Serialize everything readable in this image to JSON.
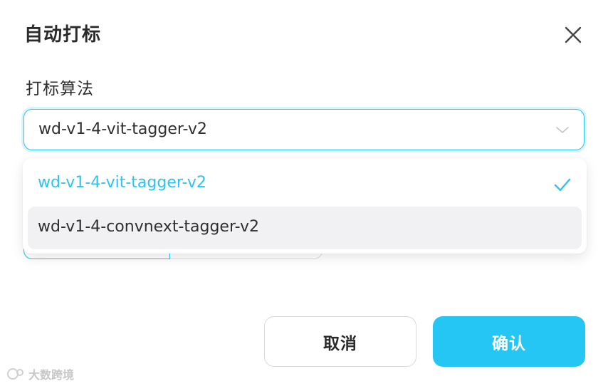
{
  "dialog": {
    "title": "自动打标",
    "close_icon": "close-icon"
  },
  "form": {
    "algorithm_label": "打标算法",
    "select": {
      "value": "wd-v1-4-vit-tagger-v2",
      "arrow_icon": "chevron-down-icon"
    },
    "options": [
      {
        "label": "wd-v1-4-vit-tagger-v2",
        "selected": true,
        "icon": "check-icon"
      },
      {
        "label": "wd-v1-4-convnext-tagger-v2",
        "selected": false,
        "hovered": true
      }
    ]
  },
  "footer": {
    "cancel_label": "取消",
    "confirm_label": "确认"
  },
  "watermark": {
    "text": "大数跨境"
  },
  "colors": {
    "accent": "#26c6f4",
    "option_hover_bg": "#f1f1f3",
    "text": "#2b2b2b"
  }
}
